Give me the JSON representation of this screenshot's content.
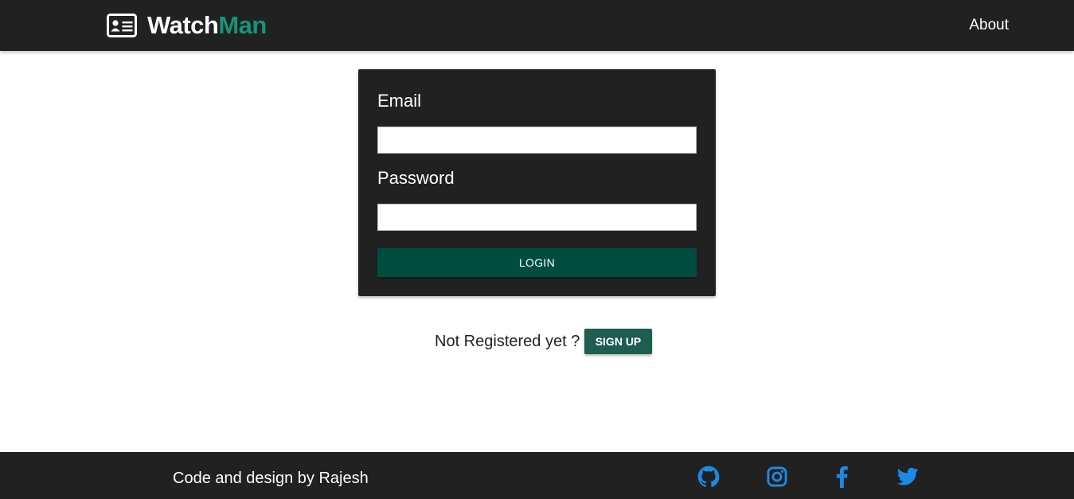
{
  "navbar": {
    "brand_part1": "Watch",
    "brand_part2": "Man",
    "brand_icon": "id-card-icon",
    "about_label": "About"
  },
  "login_form": {
    "email_label": "Email",
    "email_value": "",
    "password_label": "Password",
    "password_value": "",
    "login_label": "LOGIN"
  },
  "register": {
    "prompt": "Not Registered yet ?",
    "signup_label": "SIGN UP"
  },
  "footer": {
    "credit": "Code and design by Rajesh",
    "social_links": [
      "github-icon",
      "instagram-icon",
      "facebook-icon",
      "twitter-icon"
    ]
  },
  "colors": {
    "bar_background": "#212121",
    "brand_accent": "#16937c",
    "login_button": "#004d40",
    "signup_button": "#1e5e50",
    "social_icon": "#1e88e5"
  }
}
